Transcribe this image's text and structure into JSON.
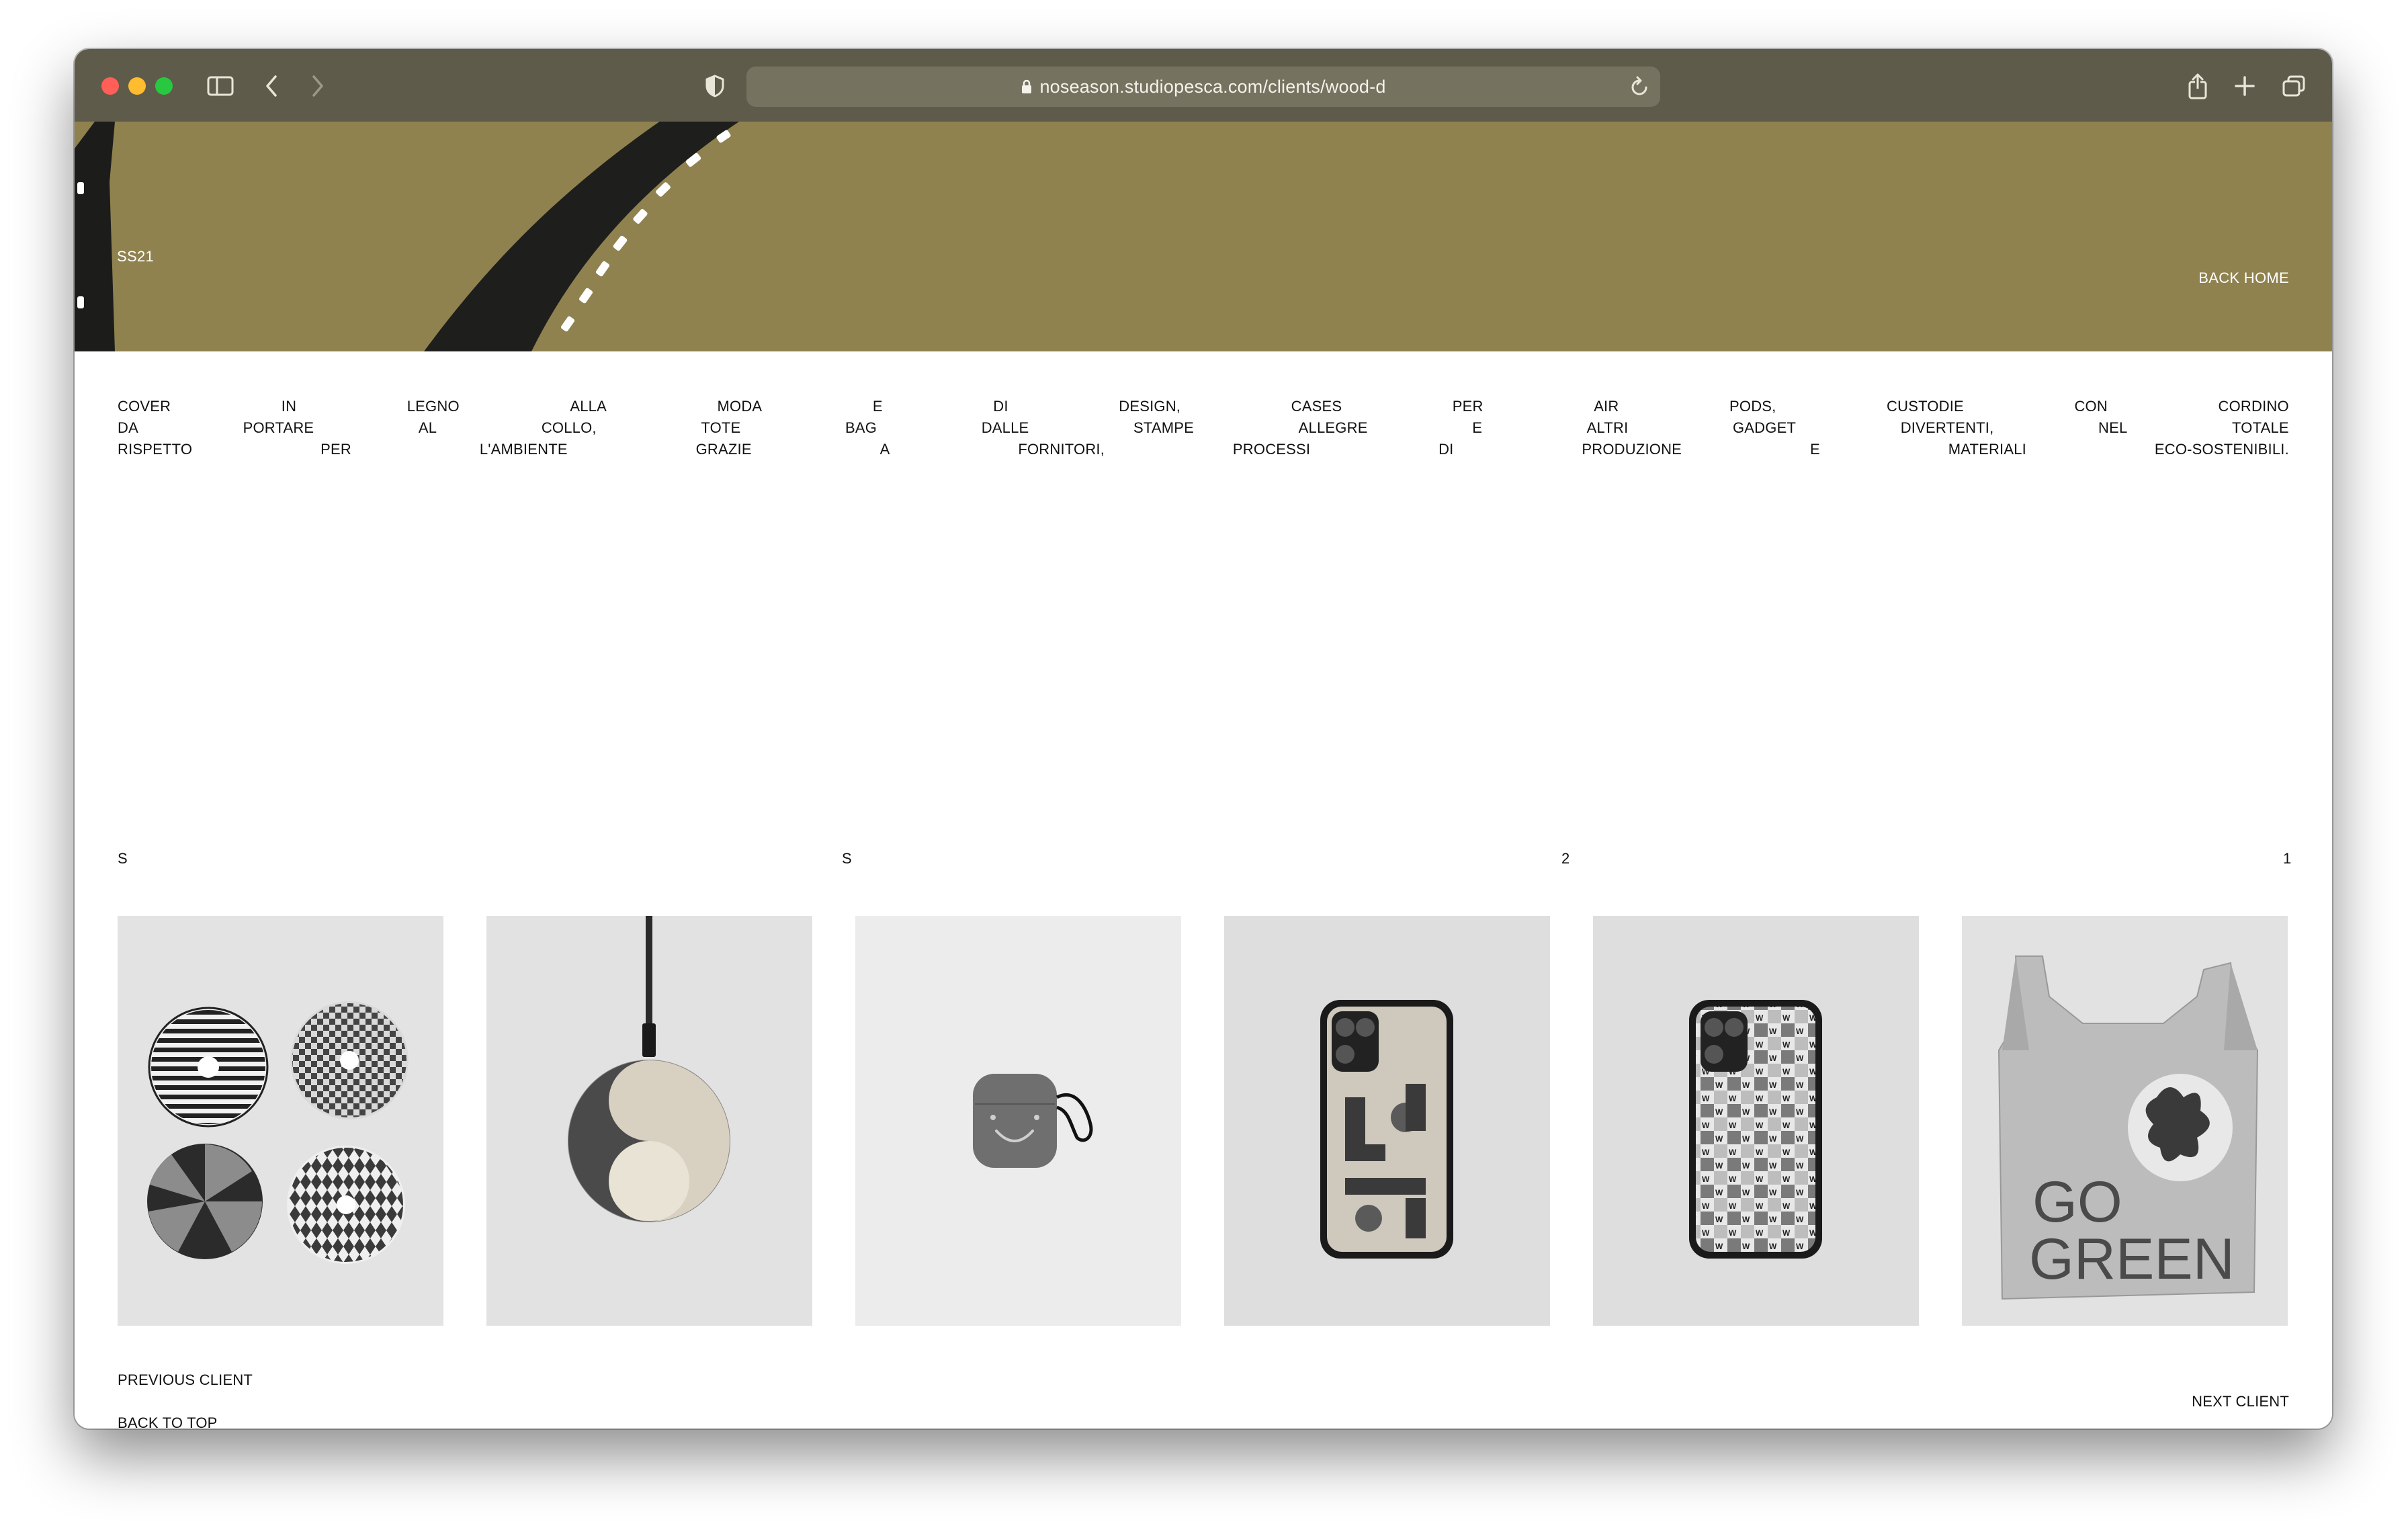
{
  "browser": {
    "url": "noseason.studiopesca.com/clients/wood-d"
  },
  "hero": {
    "season_label": "SS21",
    "back_home": "BACK HOME",
    "background_color": "#8f824f"
  },
  "description": {
    "lines": [
      [
        "COVER",
        "IN",
        "LEGNO",
        "ALLA",
        "MODA",
        "E",
        "DI",
        "DESIGN,",
        "CASES",
        "PER",
        "AIR",
        "PODS,",
        "CUSTODIE",
        "CON",
        "CORDINO"
      ],
      [
        "DA",
        "PORTARE",
        "AL",
        "COLLO,",
        "TOTE",
        "BAG",
        "DALLE",
        "STAMPE",
        "ALLEGRE",
        "E",
        "ALTRI",
        "GADGET",
        "DIVERTENTI,",
        "NEL",
        "TOTALE"
      ],
      [
        "RISPETTO",
        "PER",
        "L'AMBIENTE",
        "GRAZIE",
        "A",
        "FORNITORI,",
        "PROCESSI",
        "DI",
        "PRODUZIONE",
        "E",
        "MATERIALI",
        "ECO-SOSTENIBILI."
      ]
    ]
  },
  "counter": {
    "chars": [
      "S",
      "S",
      "2",
      "1"
    ]
  },
  "gallery": {
    "items": [
      {
        "name": "patterned wooden coasters"
      },
      {
        "name": "wooden wireless charger"
      },
      {
        "name": "airpods case"
      },
      {
        "name": "wooden phone case geometric"
      },
      {
        "name": "phone case w pattern"
      },
      {
        "name": "go green tote bag"
      }
    ]
  },
  "footer": {
    "previous_client": "PREVIOUS CLIENT",
    "back_to_top": "BACK TO TOP",
    "next_client": "NEXT CLIENT"
  }
}
